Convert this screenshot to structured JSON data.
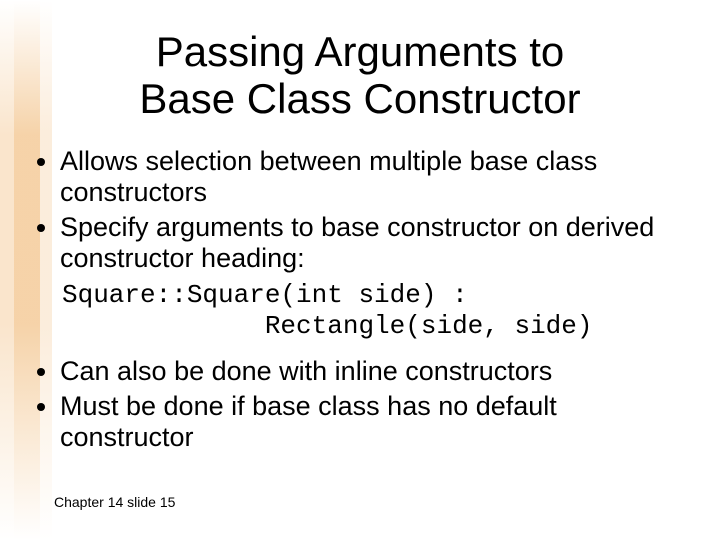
{
  "title_line1": "Passing Arguments to",
  "title_line2": "Base Class Constructor",
  "bullets_top": [
    "Allows selection between multiple base class constructors",
    "Specify arguments to base constructor on derived constructor heading:"
  ],
  "code_line1": "Square::Square(int side) :",
  "code_line2": "             Rectangle(side, side)",
  "bullets_bottom": [
    "Can also be done with inline constructors",
    "Must be done if base class has no default constructor"
  ],
  "footer": "Chapter 14 slide 15"
}
